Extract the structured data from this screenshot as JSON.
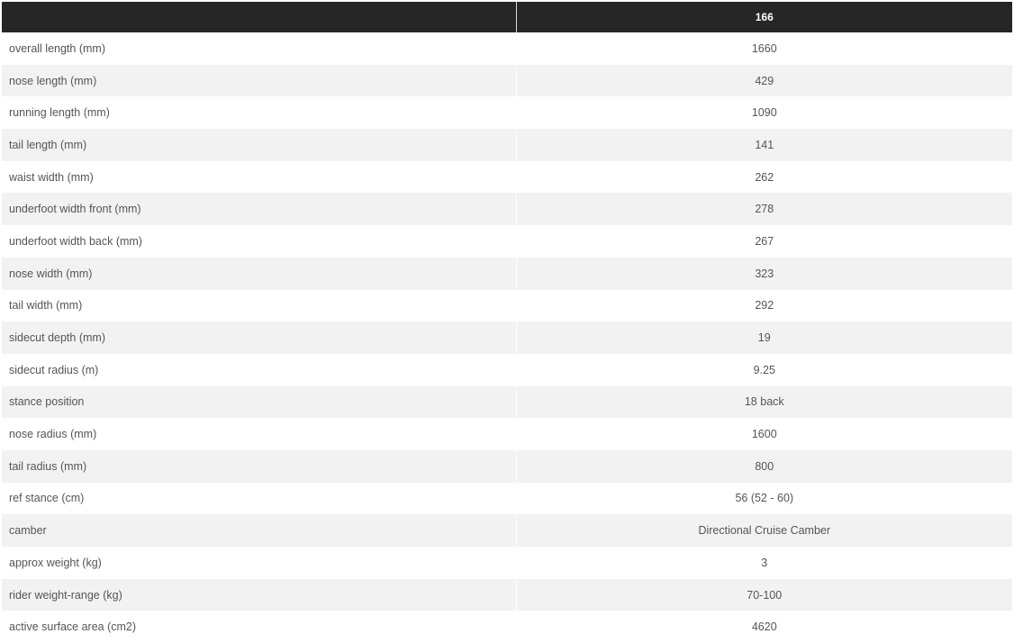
{
  "header": {
    "left": "",
    "size": "166"
  },
  "rows": [
    {
      "label": "overall length (mm)",
      "value": "1660"
    },
    {
      "label": "nose length (mm)",
      "value": "429"
    },
    {
      "label": "running length (mm)",
      "value": "1090"
    },
    {
      "label": "tail length (mm)",
      "value": "141"
    },
    {
      "label": "waist width (mm)",
      "value": "262"
    },
    {
      "label": "underfoot width front (mm)",
      "value": "278"
    },
    {
      "label": "underfoot width back (mm)",
      "value": "267"
    },
    {
      "label": "nose width (mm)",
      "value": "323"
    },
    {
      "label": "tail width (mm)",
      "value": "292"
    },
    {
      "label": "sidecut depth (mm)",
      "value": "19"
    },
    {
      "label": "sidecut radius (m)",
      "value": "9.25"
    },
    {
      "label": "stance position",
      "value": "18 back"
    },
    {
      "label": "nose radius (mm)",
      "value": "1600"
    },
    {
      "label": "tail radius (mm)",
      "value": "800"
    },
    {
      "label": "ref stance (cm)",
      "value": "56 (52 - 60)"
    },
    {
      "label": "camber",
      "value": "Directional Cruise Camber"
    },
    {
      "label": "approx weight (kg)",
      "value": "3"
    },
    {
      "label": "rider weight-range (kg)",
      "value": "70-100"
    },
    {
      "label": "active surface area (cm2)",
      "value": "4620"
    }
  ],
  "colors": {
    "header_bg": "#262626",
    "header_text": "#ffffff",
    "row_alt_bg": "#f2f2f2",
    "row_bg": "#ffffff",
    "body_text": "#555555"
  }
}
